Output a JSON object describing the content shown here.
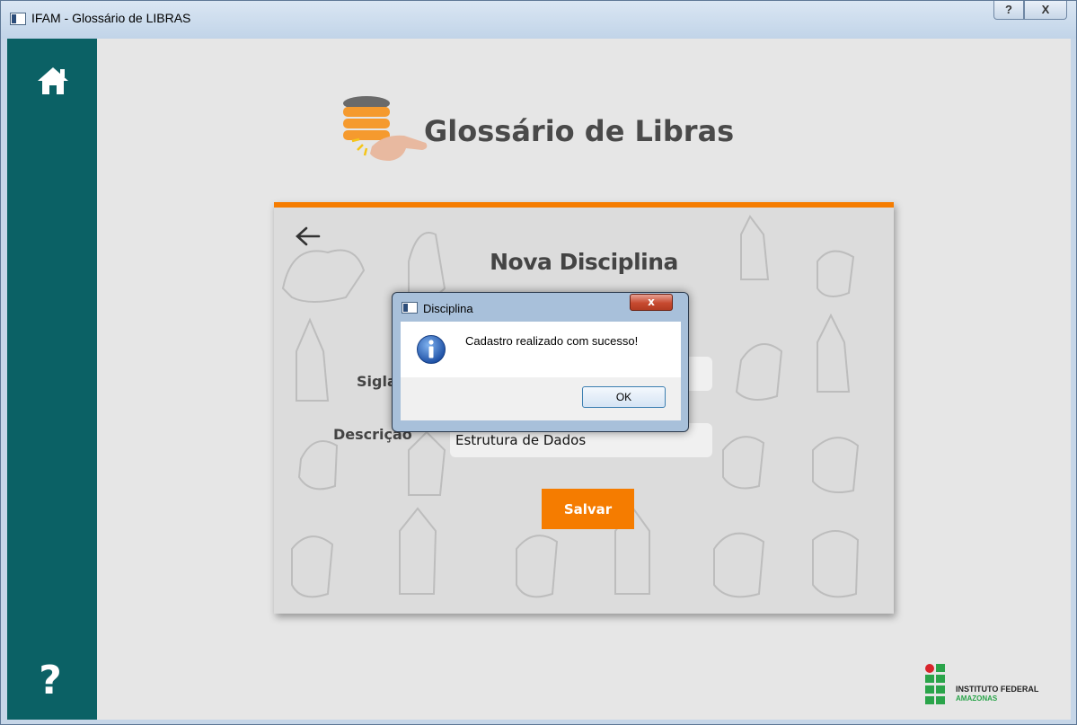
{
  "window": {
    "title": "IFAM - Glossário de LIBRAS",
    "help_label": "?",
    "close_label": "X"
  },
  "sidebar": {
    "home_icon": "home-icon",
    "help_icon": "question-icon",
    "help_symbol": "?"
  },
  "header": {
    "title": "Glossário de Libras"
  },
  "form": {
    "title": "Nova Disciplina",
    "sigla_label": "Sigla",
    "sigla_value": "",
    "descricao_label": "Descrição",
    "descricao_value": "Estrutura de Dados",
    "save_label": "Salvar",
    "back_icon": "arrow-left-icon"
  },
  "dialog": {
    "title": "Disciplina",
    "close_label": "x",
    "message": "Cadastro realizado com sucesso!",
    "icon": "info-icon",
    "ok_label": "OK"
  },
  "institution": {
    "line1": "INSTITUTO FEDERAL",
    "line2": "AMAZONAS"
  },
  "colors": {
    "sidebar": "#0b6165",
    "accent": "#f57c00",
    "background": "#e6e6e6"
  }
}
